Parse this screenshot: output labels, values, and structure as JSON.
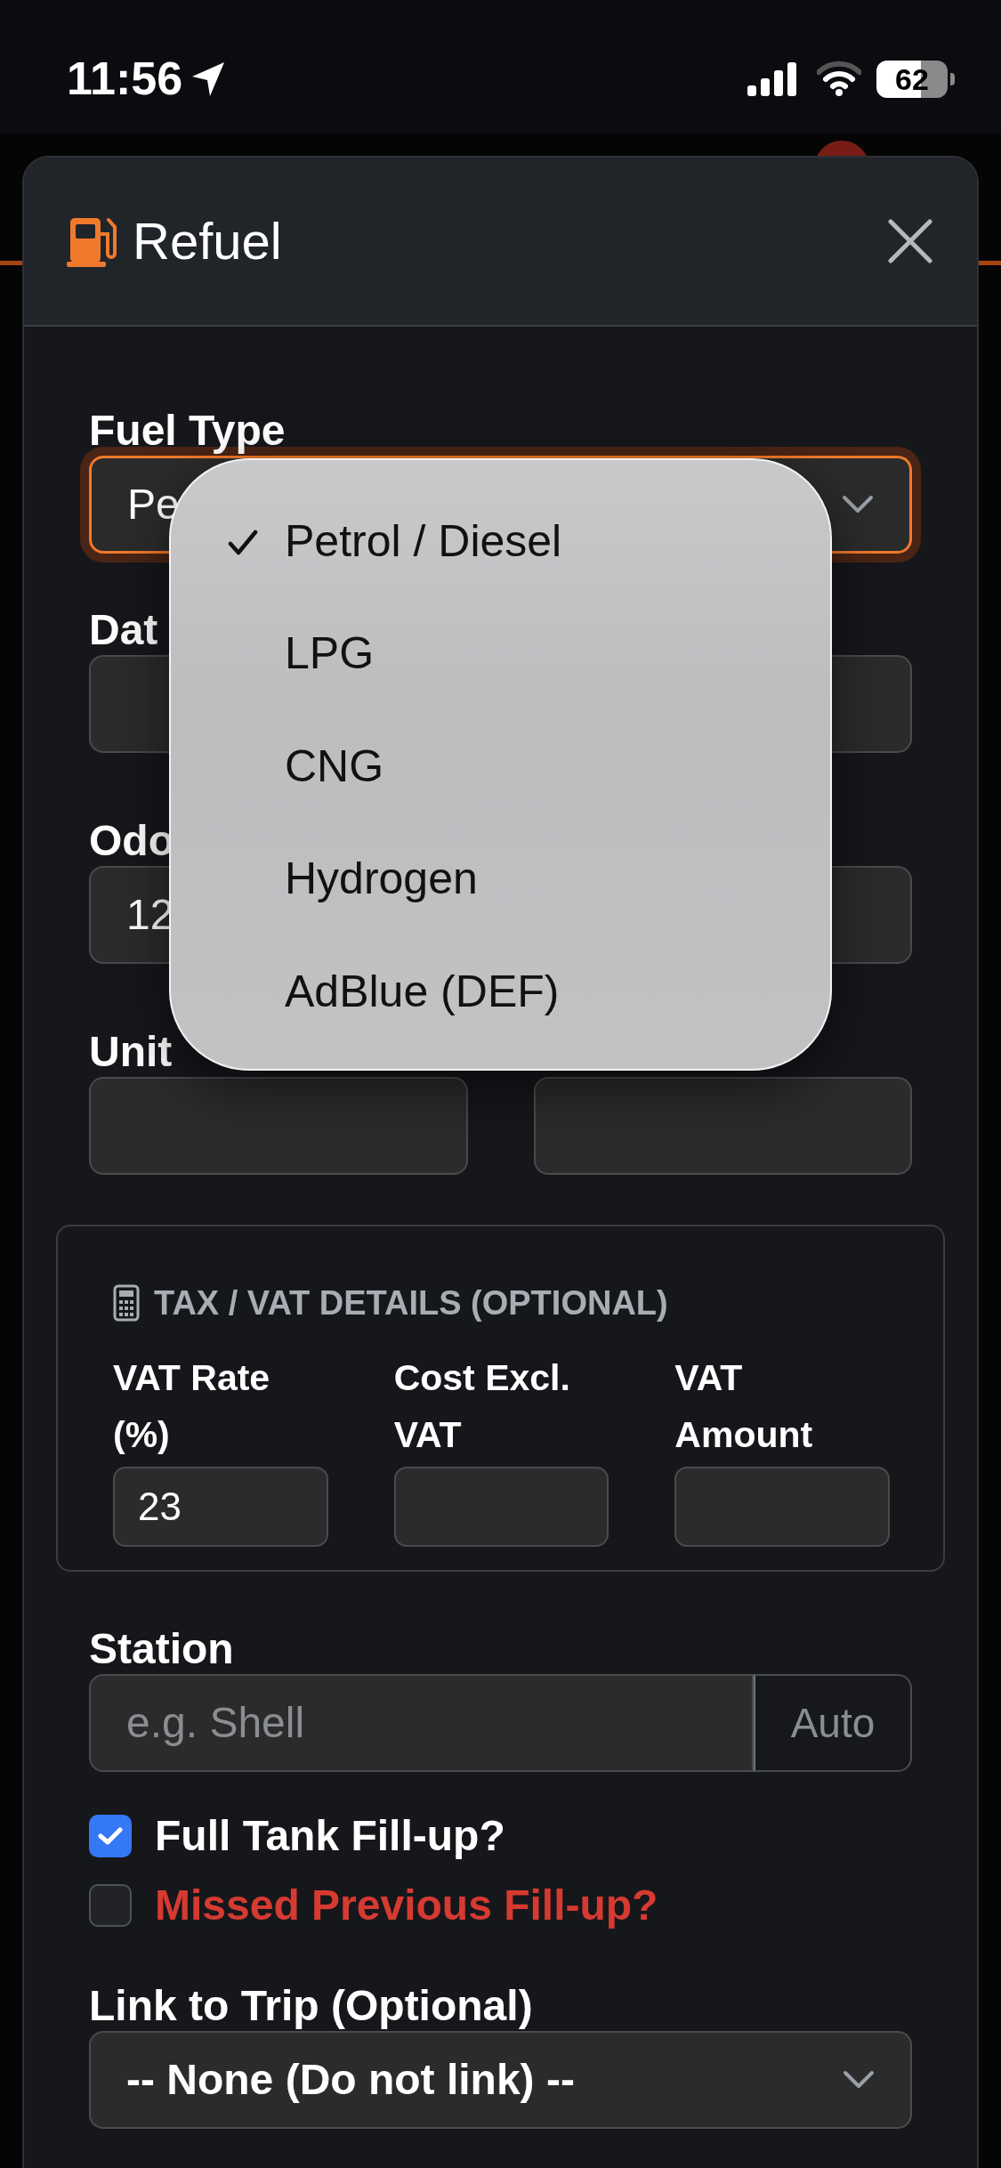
{
  "status_bar": {
    "time": "11:56",
    "battery": "62"
  },
  "modal": {
    "title": "Refuel"
  },
  "fuel_type": {
    "label": "Fuel Type",
    "value": "Pe",
    "focused": true
  },
  "date": {
    "label": "Dat"
  },
  "odometer": {
    "label": "Odo",
    "value": "12"
  },
  "unit_price": {
    "label": "Unit"
  },
  "tax": {
    "heading": "TAX / VAT DETAILS (OPTIONAL)",
    "fields": [
      {
        "label": "VAT Rate (%)",
        "value": "23"
      },
      {
        "label": "Cost Excl. VAT"
      },
      {
        "label": "VAT Amount"
      }
    ]
  },
  "station": {
    "label": "Station",
    "placeholder": "e.g. Shell",
    "addon": "Auto"
  },
  "checkboxes": [
    {
      "label": "Full Tank Fill-up?",
      "checked": true,
      "color": "#ffffff"
    },
    {
      "label": "Missed Previous Fill-up?",
      "checked": false,
      "color": "#d63a31"
    }
  ],
  "trip": {
    "label": "Link to Trip (Optional)",
    "value": "-- None (Do not link) --"
  },
  "fuel_menu": {
    "options": [
      {
        "label": "Petrol / Diesel",
        "selected": true
      },
      {
        "label": "LPG",
        "selected": false
      },
      {
        "label": "CNG",
        "selected": false
      },
      {
        "label": "Hydrogen",
        "selected": false
      },
      {
        "label": "AdBlue (DEF)",
        "selected": false
      }
    ]
  }
}
